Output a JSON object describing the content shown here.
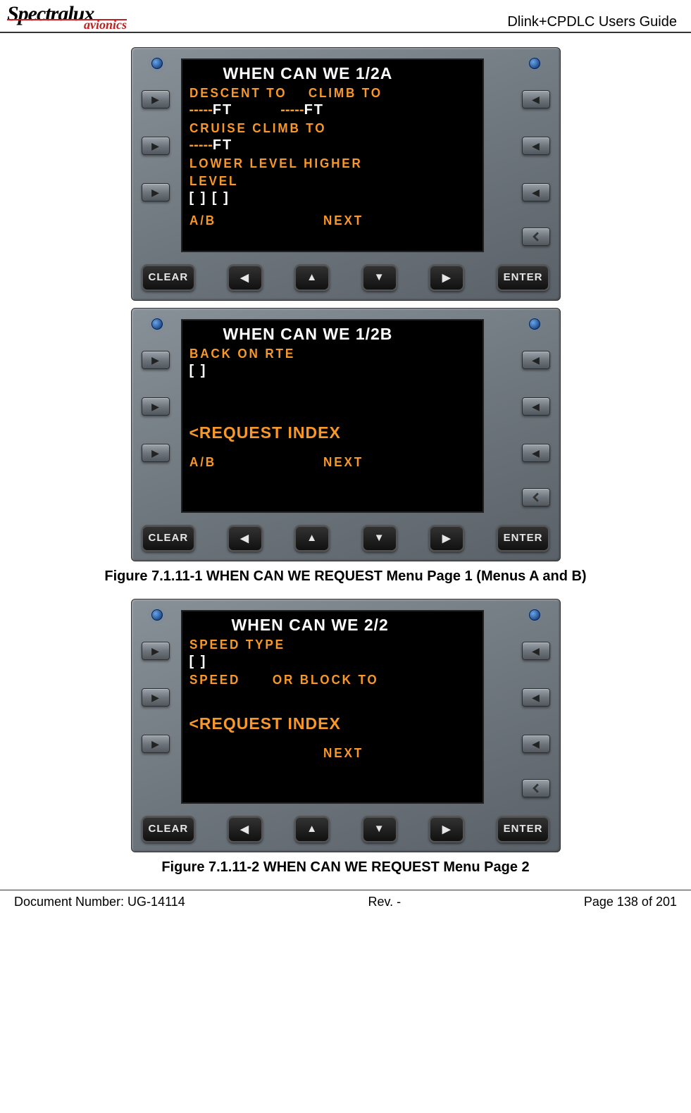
{
  "header": {
    "logo_main_pre": "Spectra",
    "logo_main_red": "lux",
    "logo_sub": "avionics",
    "title": "Dlink+CPDLC Users Guide"
  },
  "screens": {
    "a": {
      "title": "WHEN CAN WE  1/2A",
      "l1_left": "DESCENT TO",
      "l1_right": "CLIMB TO",
      "v1_left_dash": "-----",
      "v1_left_unit": "FT",
      "v1_right_dash": "-----",
      "v1_right_unit": "FT",
      "l2": "CRUISE CLIMB TO",
      "v2_dash": "-----",
      "v2_unit": "FT",
      "l3a": "LOWER LEVEL HIGHER",
      "l3b": "LEVEL",
      "v3": "[    ] [    ]",
      "foot_left": "A/B",
      "foot_right": "NEXT"
    },
    "b": {
      "title": "WHEN CAN WE  1/2B",
      "l1": "BACK ON RTE",
      "v1": "[    ]",
      "link": "<REQUEST INDEX",
      "foot_left": "A/B",
      "foot_right": "NEXT"
    },
    "c": {
      "title": "WHEN CAN WE  2/2",
      "l1": "SPEED TYPE",
      "v1": "[  ]",
      "l2_left": "SPEED",
      "l2_right": "OR BLOCK TO",
      "link": "<REQUEST INDEX",
      "foot_right": "NEXT"
    }
  },
  "buttons": {
    "clear": "CLEAR",
    "enter": "ENTER"
  },
  "captions": {
    "fig1": "Figure 7.1.11-1 WHEN CAN WE REQUEST Menu Page 1 (Menus A and B)",
    "fig2": "Figure 7.1.11-2 WHEN CAN WE REQUEST Menu Page 2"
  },
  "footer": {
    "doc": "Document Number:  UG-14114",
    "rev": "Rev. -",
    "page": "Page 138 of 201"
  }
}
